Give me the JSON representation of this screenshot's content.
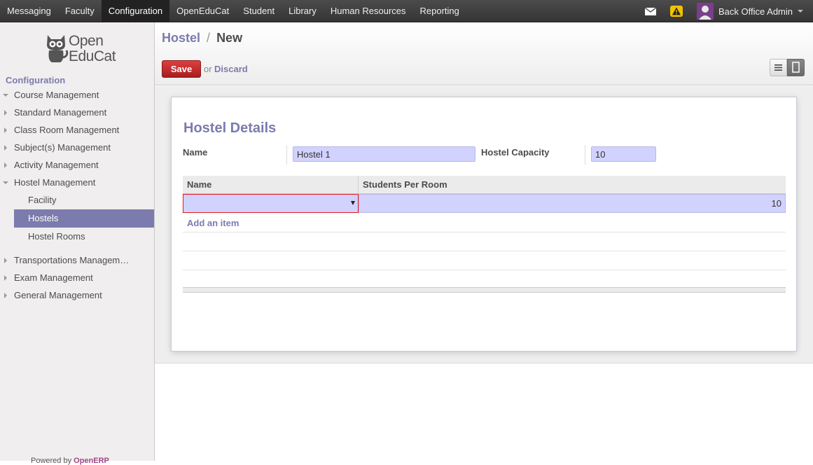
{
  "topbar": {
    "menu": [
      {
        "label": "Messaging",
        "active": false
      },
      {
        "label": "Faculty",
        "active": false
      },
      {
        "label": "Configuration",
        "active": true
      },
      {
        "label": "OpenEduCat",
        "active": false
      },
      {
        "label": "Student",
        "active": false
      },
      {
        "label": "Library",
        "active": false
      },
      {
        "label": "Human Resources",
        "active": false
      },
      {
        "label": "Reporting",
        "active": false
      }
    ],
    "user_name": "Back Office Admin",
    "icons": [
      "mail-icon",
      "warning-icon",
      "avatar"
    ]
  },
  "sidebar": {
    "logo_line1": "Open",
    "logo_line2": "EduCat",
    "section_title": "Configuration",
    "items": [
      {
        "label": "Course Management",
        "expanded": true
      },
      {
        "label": "Standard Management",
        "expanded": false
      },
      {
        "label": "Class Room Management",
        "expanded": false
      },
      {
        "label": "Subject(s) Management",
        "expanded": false
      },
      {
        "label": "Activity Management",
        "expanded": false
      },
      {
        "label": "Hostel Management",
        "expanded": true
      },
      {
        "label": "Transportations Managem…",
        "expanded": false
      },
      {
        "label": "Exam Management",
        "expanded": false
      },
      {
        "label": "General Management",
        "expanded": false
      }
    ],
    "subitems": [
      {
        "label": "Facility",
        "active": false
      },
      {
        "label": "Hostels",
        "active": true
      },
      {
        "label": "Hostel Rooms",
        "active": false
      }
    ],
    "powered_prefix": "Powered by ",
    "powered_brand": "OpenERP"
  },
  "header": {
    "breadcrumb_parent": "Hostel",
    "breadcrumb_sep": "/",
    "breadcrumb_current": "New",
    "save_label": "Save",
    "or_text": "or",
    "discard_label": "Discard"
  },
  "form": {
    "title": "Hostel Details",
    "name_label": "Name",
    "name_value": "Hostel 1",
    "capacity_label": "Hostel Capacity",
    "capacity_value": "10",
    "table": {
      "columns": [
        "Name",
        "Students Per Room"
      ],
      "edit_row": {
        "name": "",
        "students_per_room": "10"
      },
      "add_item_label": "Add an item"
    }
  },
  "colors": {
    "accent": "#7c7bad",
    "save_button": "#c02828",
    "field_bg": "#d2d2ff",
    "invalid_border": "#e31a1a"
  }
}
